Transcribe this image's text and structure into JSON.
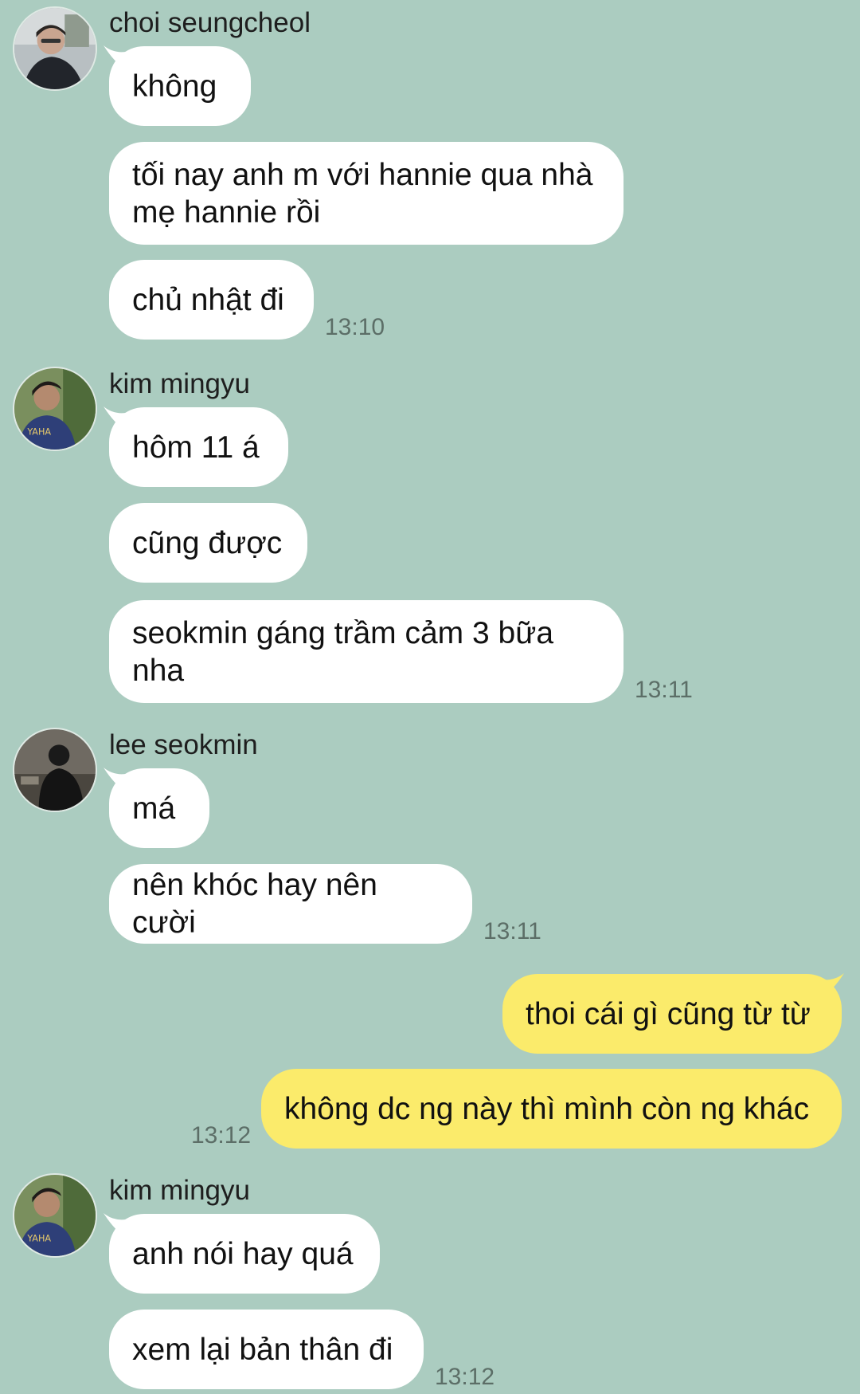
{
  "chat": {
    "groups": [
      {
        "sender": "choi seungcheol",
        "avatar_icon": "person-avatar-icon",
        "messages": [
          "không",
          "tối nay anh m với hannie qua nhà mẹ hannie rồi",
          "chủ nhật đi"
        ],
        "time": "13:10"
      },
      {
        "sender": "kim mingyu",
        "avatar_icon": "person-avatar-icon",
        "messages": [
          "hôm 11 á",
          "cũng được",
          "seokmin gáng trầm cảm 3 bữa nha"
        ],
        "time": "13:11"
      },
      {
        "sender": "lee seokmin",
        "avatar_icon": "person-avatar-icon",
        "messages": [
          "má",
          "nên khóc hay nên cười"
        ],
        "time": "13:11"
      },
      {
        "sender": "me",
        "messages": [
          "thoi cái gì cũng từ từ",
          "không dc ng này thì mình còn ng khác"
        ],
        "time": "13:12"
      },
      {
        "sender": "kim mingyu",
        "avatar_icon": "person-avatar-icon",
        "messages": [
          "anh nói hay quá",
          "xem lại bản thân đi"
        ],
        "time": "13:12"
      }
    ]
  },
  "colors": {
    "background": "#abccc0",
    "incoming_bubble": "#ffffff",
    "outgoing_bubble": "#fbeb6b"
  }
}
